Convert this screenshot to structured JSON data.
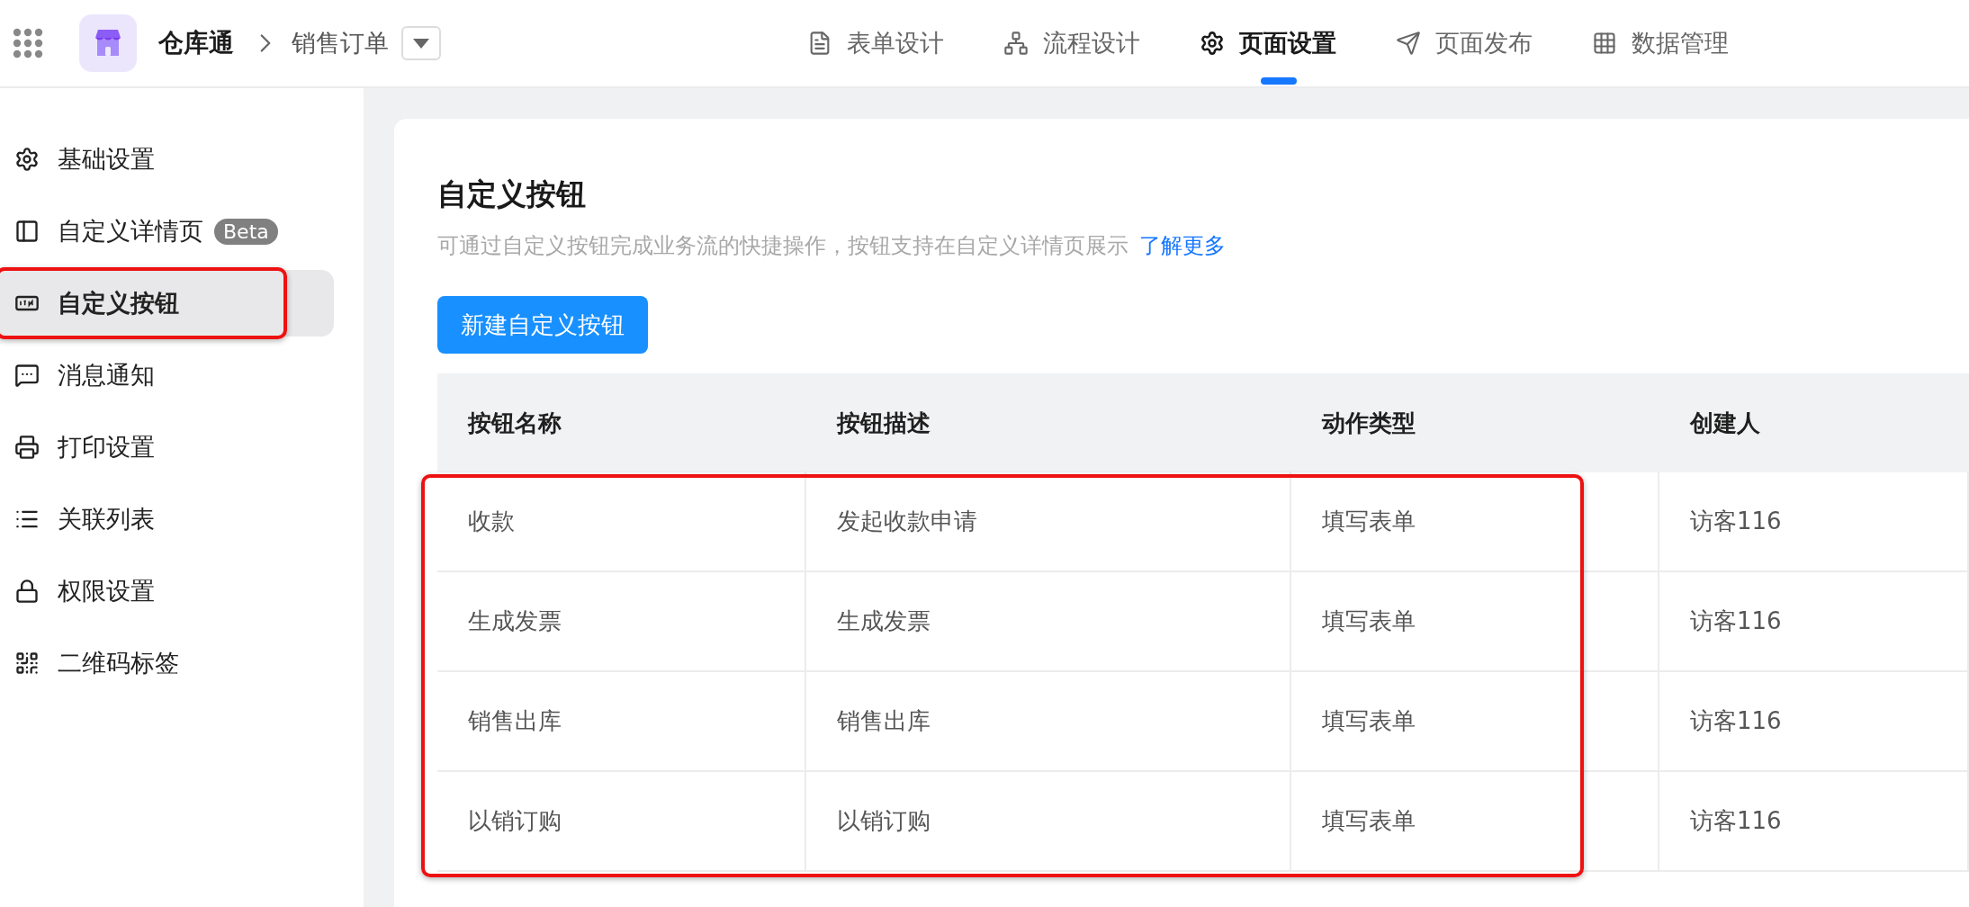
{
  "header": {
    "app_name": "仓库通",
    "form_name": "销售订单"
  },
  "tabs": [
    {
      "label": "表单设计",
      "selected": false
    },
    {
      "label": "流程设计",
      "selected": false
    },
    {
      "label": "页面设置",
      "selected": true
    },
    {
      "label": "页面发布",
      "selected": false
    },
    {
      "label": "数据管理",
      "selected": false
    }
  ],
  "sidebar": {
    "items": [
      {
        "label": "基础设置",
        "selected": false,
        "highlighted": false
      },
      {
        "label": "自定义详情页",
        "badge": "Beta",
        "selected": false,
        "highlighted": false
      },
      {
        "label": "自定义按钮",
        "selected": true,
        "highlighted": true
      },
      {
        "label": "消息通知",
        "selected": false,
        "highlighted": false
      },
      {
        "label": "打印设置",
        "selected": false,
        "highlighted": false
      },
      {
        "label": "关联列表",
        "selected": false,
        "highlighted": false
      },
      {
        "label": "权限设置",
        "selected": false,
        "highlighted": false
      },
      {
        "label": "二维码标签",
        "selected": false,
        "highlighted": false
      }
    ]
  },
  "content": {
    "title": "自定义按钮",
    "description": "可通过自定义按钮完成业务流的快捷操作，按钮支持在自定义详情页展示",
    "link": "了解更多",
    "new_button": "新建自定义按钮"
  },
  "table": {
    "highlighted": true,
    "columns": [
      "按钮名称",
      "按钮描述",
      "动作类型",
      "创建人"
    ],
    "rows": [
      [
        "收款",
        "发起收款申请",
        "填写表单",
        "访客116"
      ],
      [
        "生成发票",
        "生成发票",
        "填写表单",
        "访客116"
      ],
      [
        "销售出库",
        "销售出库",
        "填写表单",
        "访客116"
      ],
      [
        "以销订购",
        "以销订购",
        "填写表单",
        "访客116"
      ]
    ]
  }
}
